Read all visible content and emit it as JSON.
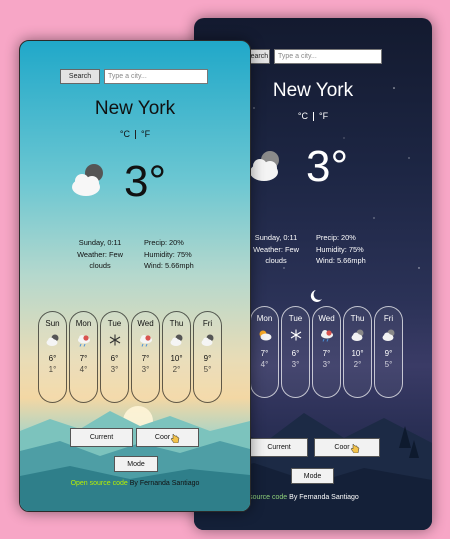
{
  "search": {
    "button_label": "Search",
    "placeholder": "Type a city..."
  },
  "weather": {
    "city": "New York",
    "unit_c": "°C",
    "unit_f": "°F",
    "temperature": "3°",
    "condition_icon": "cloudy-night-icon",
    "date_time": "Sunday, 0:11",
    "weather_line1": "Weather: Few",
    "weather_line2": "clouds",
    "precip": "Precip: 20%",
    "humidity": "Humidity: 75%",
    "wind": "Wind: 5.66mph"
  },
  "forecast_light": [
    {
      "day": "Sun",
      "icon": "cloudy-night-icon",
      "high": "6°",
      "low": "1°"
    },
    {
      "day": "Mon",
      "icon": "rain-icon",
      "high": "7°",
      "low": "4°"
    },
    {
      "day": "Tue",
      "icon": "snowflake-icon",
      "high": "6°",
      "low": "3°"
    },
    {
      "day": "Wed",
      "icon": "rain-icon",
      "high": "7°",
      "low": "3°"
    },
    {
      "day": "Thu",
      "icon": "cloudy-night-icon",
      "high": "10°",
      "low": "2°"
    },
    {
      "day": "Fri",
      "icon": "cloudy-night-icon",
      "high": "9°",
      "low": "5°"
    }
  ],
  "forecast_dark": [
    {
      "day": "Mon",
      "icon": "partly-cloudy-icon",
      "high": "7°",
      "low": "4°"
    },
    {
      "day": "Tue",
      "icon": "snowflake-icon",
      "high": "6°",
      "low": "3°"
    },
    {
      "day": "Wed",
      "icon": "rain-icon",
      "high": "7°",
      "low": "3°"
    },
    {
      "day": "Thu",
      "icon": "cloudy-night-icon",
      "high": "10°",
      "low": "2°"
    },
    {
      "day": "Fri",
      "icon": "cloudy-night-icon",
      "high": "9°",
      "low": "5°"
    }
  ],
  "buttons": {
    "current": "Current",
    "coords": "Coor",
    "mode": "Mode"
  },
  "footer": {
    "link": "Open source code",
    "author": "By Fernanda Santiago"
  },
  "colors": {
    "pink_bg": "#f7a6c6",
    "link_green": "#b8f000",
    "light_text": "#111111",
    "dark_text": "#ffffff"
  }
}
